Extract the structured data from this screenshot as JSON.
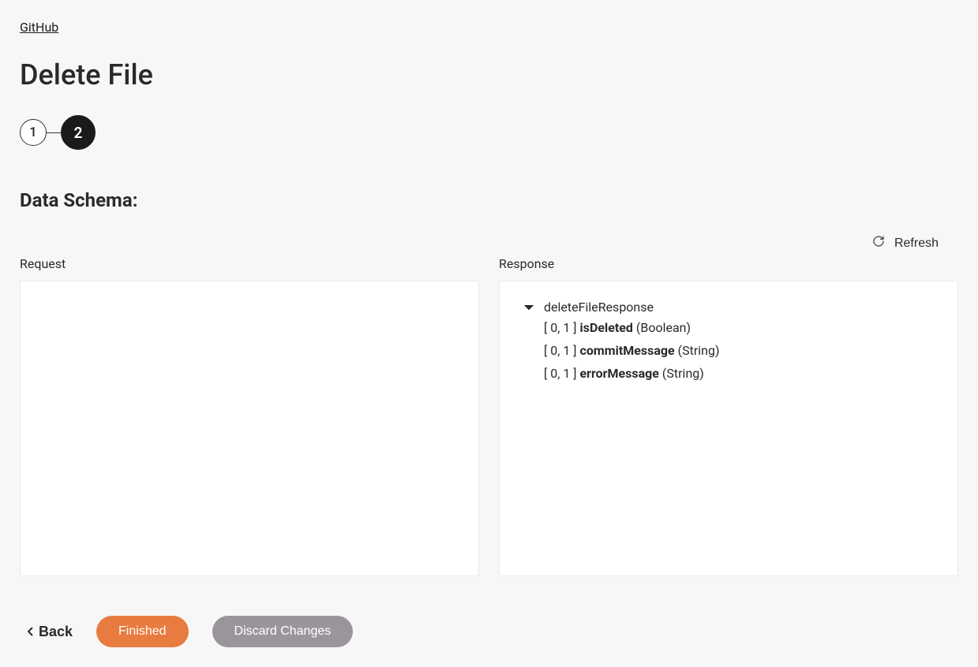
{
  "breadcrumb": {
    "label": "GitHub"
  },
  "page": {
    "title": "Delete File"
  },
  "stepper": {
    "step1": "1",
    "step2": "2"
  },
  "schema": {
    "heading": "Data Schema:",
    "refresh_label": "Refresh",
    "request_label": "Request",
    "response_label": "Response",
    "response": {
      "root_name": "deleteFileResponse",
      "fields": [
        {
          "card": "[ 0, 1 ] ",
          "name": "isDeleted",
          "type": " (Boolean)"
        },
        {
          "card": "[ 0, 1 ] ",
          "name": "commitMessage",
          "type": " (String)"
        },
        {
          "card": "[ 0, 1 ] ",
          "name": "errorMessage",
          "type": " (String)"
        }
      ]
    }
  },
  "footer": {
    "back": "Back",
    "finished": "Finished",
    "discard": "Discard Changes"
  }
}
